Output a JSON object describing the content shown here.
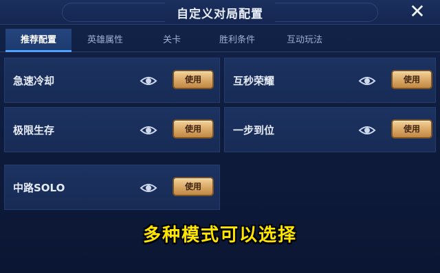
{
  "header": {
    "title": "自定义对局配置",
    "close_symbol": "✕"
  },
  "tabs": [
    {
      "label": "推荐配置",
      "active": true
    },
    {
      "label": "英雄属性",
      "active": false
    },
    {
      "label": "关卡",
      "active": false
    },
    {
      "label": "胜利条件",
      "active": false
    },
    {
      "label": "互动玩法",
      "active": false
    }
  ],
  "modes": [
    {
      "label": "急速冷却",
      "button": "使用",
      "icon": "eye-icon"
    },
    {
      "label": "互秒荣耀",
      "button": "使用",
      "icon": "eye-icon"
    },
    {
      "label": "极限生存",
      "button": "使用",
      "icon": "eye-icon"
    },
    {
      "label": "一步到位",
      "button": "使用",
      "icon": "eye-icon"
    },
    {
      "label": "中路SOLO",
      "button": "使用",
      "icon": "eye-icon"
    }
  ],
  "caption": "多种模式可以选择",
  "colors": {
    "accent_tab": "#4fa3ff",
    "button_gold": "#d9a764",
    "caption_yellow": "#ffe600"
  }
}
